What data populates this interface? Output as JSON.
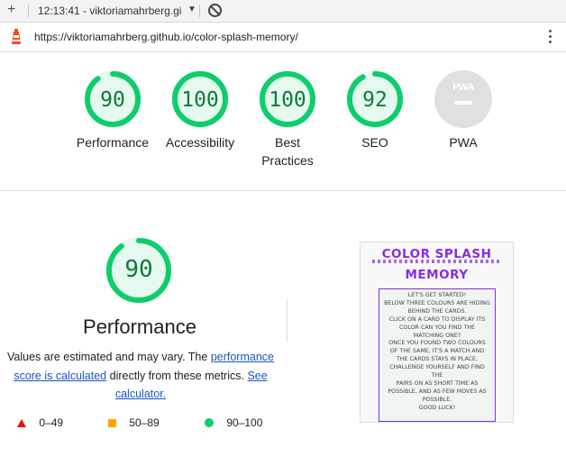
{
  "toolbar": {
    "plus_icon": "plus-icon",
    "tab_title": "12:13:41 - viktoriamahrberg.gi",
    "caret_icon": "caret-down-icon",
    "blocked_icon": "block-icon"
  },
  "urlbar": {
    "url": "https://viktoriamahrberg.github.io/color-splash-memory/",
    "logo_icon": "lighthouse-icon",
    "menu_icon": "vertical-dots-icon"
  },
  "categories": [
    {
      "score": "90",
      "label": "Performance",
      "fraction": 0.9
    },
    {
      "score": "100",
      "label": "Accessibility",
      "fraction": 1.0
    },
    {
      "score": "100",
      "label": "Best Practices",
      "label_line1": "Best",
      "label_line2": "Practices",
      "fraction": 1.0
    },
    {
      "score": "92",
      "label": "SEO",
      "fraction": 0.92
    },
    {
      "score": "PWA",
      "label": "PWA"
    }
  ],
  "detail": {
    "score": "90",
    "score_fraction": 0.9,
    "title": "Performance",
    "desc_part1": "Values are estimated and may vary. The ",
    "link1_line1": "performance",
    "link1_line2": "score is calculated",
    "desc_part2": " directly from these metrics. ",
    "link2_line1": "See",
    "link2_line2": "calculator."
  },
  "legend": [
    {
      "range": "0–49",
      "icon": "fail-triangle-icon",
      "color": "#eb0f00"
    },
    {
      "range": "50–89",
      "icon": "average-square-icon",
      "color": "#ffa400"
    },
    {
      "range": "90–100",
      "icon": "pass-circle-icon",
      "color": "#0cce6b"
    }
  ],
  "thumbnail": {
    "title_line1": "COLOR SPLASH",
    "title_line2": "MEMORY",
    "body": "LET'S GET STARTED!\nBELOW THREE COLOURS ARE HIDING\nBEHIND THE CARDS.\nCLICK ON A CARD TO DISPLAY ITS\nCOLOR CAN YOU FIND THE\nMATCHING ONE?\nONCE YOU FOUND TWO COLOURS\nOF THE SAME, IT'S A MATCH AND\nTHE CARDS STAYS IN PLACE.\nCHALLENGE YOURSELF AND FIND THE\nPAIRS ON AS SHORT TIME AS\nPOSSIBLE, AND AS FEW MOVES AS\nPOSSIBLE.\nGOOD LUCK!"
  },
  "colors": {
    "pass": "#0cce6b",
    "pass_text": "#0c7a3a",
    "pass_bg": "#e6f9ef",
    "link": "#1a55c4",
    "accent_purple": "#8a2be2"
  }
}
